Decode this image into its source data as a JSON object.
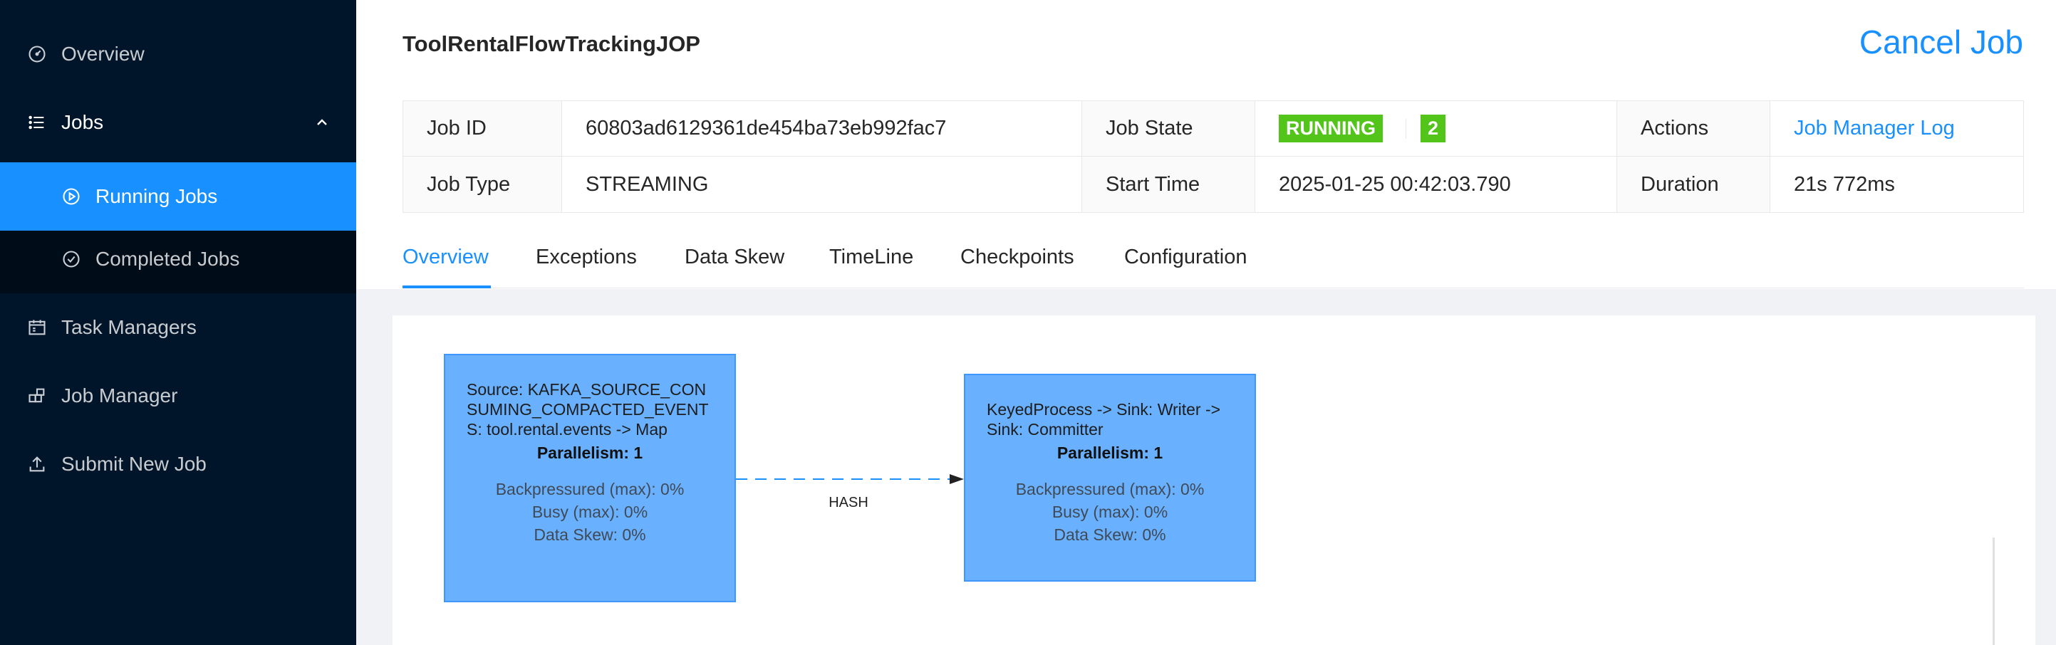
{
  "sidebar": {
    "items": [
      {
        "label": "Overview",
        "icon": "dashboard-icon"
      },
      {
        "label": "Jobs",
        "icon": "list-icon"
      },
      {
        "label": "Running Jobs",
        "icon": "play-circle-icon"
      },
      {
        "label": "Completed Jobs",
        "icon": "check-circle-icon"
      },
      {
        "label": "Task Managers",
        "icon": "calendar-icon"
      },
      {
        "label": "Job Manager",
        "icon": "build-icon"
      },
      {
        "label": "Submit New Job",
        "icon": "upload-icon"
      }
    ]
  },
  "job": {
    "name": "ToolRentalFlowTrackingJOP",
    "cancel_label": "Cancel Job",
    "id_label": "Job ID",
    "id": "60803ad6129361de454ba73eb992fac7",
    "state_label": "Job State",
    "state": "RUNNING",
    "state_count": "2",
    "actions_label": "Actions",
    "actions_link": "Job Manager Log",
    "type_label": "Job Type",
    "type": "STREAMING",
    "start_label": "Start Time",
    "start": "2025-01-25 00:42:03.790",
    "duration_label": "Duration",
    "duration": "21s 772ms"
  },
  "tabs": [
    "Overview",
    "Exceptions",
    "Data Skew",
    "TimeLine",
    "Checkpoints",
    "Configuration"
  ],
  "graph": {
    "nodes": [
      {
        "name": "Source: KAFKA_SOURCE_CONSUMING_COMPACTED_EVENTS: tool.rental.events -> Map",
        "parallelism": "Parallelism: 1",
        "backpressured": "Backpressured (max): 0%",
        "busy": "Busy (max): 0%",
        "skew": "Data Skew: 0%"
      },
      {
        "name": "KeyedProcess -> Sink: Writer -> Sink: Committer",
        "parallelism": "Parallelism: 1",
        "backpressured": "Backpressured (max): 0%",
        "busy": "Busy (max): 0%",
        "skew": "Data Skew: 0%"
      }
    ],
    "edge_label": "HASH"
  },
  "colors": {
    "sidebar_bg": "#001529",
    "accent": "#1890ff",
    "running": "#52c41a",
    "node_fill": "#69b1ff"
  }
}
